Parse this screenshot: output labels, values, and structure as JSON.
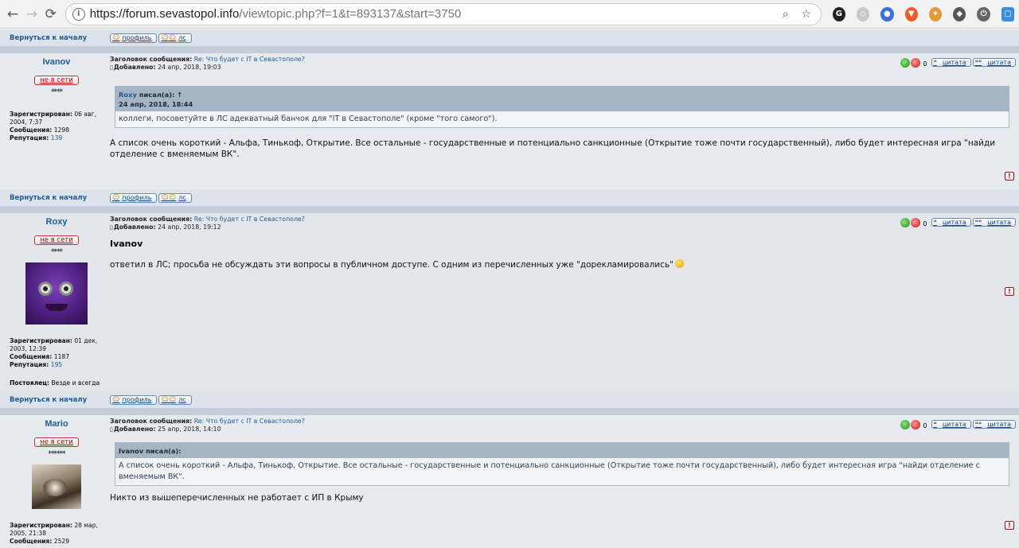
{
  "browser": {
    "url_host": "https://forum.sevastopol.info",
    "url_path": "/viewtopic.php?f=1&t=893137&start=3750",
    "back_icon": "arrow-left",
    "forward_icon": "arrow-right",
    "reload_icon": "reload",
    "info_icon": "info-circle",
    "zoom_icon": "magnifier",
    "bookmark_icon": "star"
  },
  "labels": {
    "back_to_top": "Вернуться к началу",
    "profile": "профиль",
    "pm": "лс",
    "offline": "не в сети",
    "quote": "цитата",
    "subject_label": "Заголовок сообщения:",
    "added_label": "Добавлено:",
    "registered_label": "Зарегистрирован:",
    "messages_label": "Сообщения:",
    "reputation_label": "Репутация:",
    "wrote": "писал(а):",
    "report": "!"
  },
  "posts": [
    {
      "author": "Ivanov",
      "stars": "****",
      "registered": "06 авг, 2004, 7:37",
      "messages": "1298",
      "reputation": "139",
      "subject": "Re: Что будет с IT в Севастополе?",
      "added": "24 апр, 2018, 19:03",
      "votes": "0",
      "quote": {
        "author": "Roxy",
        "arrow": "↑",
        "date": "24 апр, 2018, 18:44",
        "text": "коллеги, посоветуйте в ЛС адекватный банчок для \"IT в Севастополе\" (кроме \"того самого\")."
      },
      "text": "А список очень короткий - Альфа, Тинькоф, Открытие. Все остальные - государственные и потенциально санкционные (Открытие тоже почти государственный), либо будет интересная игра \"найди отделение с вменяемым ВК\"."
    },
    {
      "author": "Roxy",
      "stars": "****",
      "registered": "01 дек, 2003, 12:39",
      "messages": "1187",
      "reputation": "195",
      "lodger_label": "Постоялец:",
      "lodger_value": "Везде и всегда",
      "subject": "Re: Что будет с IT в Севастополе?",
      "added": "24 апр, 2018, 19:12",
      "votes": "0",
      "title": "Ivanov",
      "text": "ответил в ЛС; просьба не обсуждать эти вопросы в публичном доступе. С одним из перечисленных уже \"дорекламировались\""
    },
    {
      "author": "Mario",
      "stars": "******",
      "registered": "28 мар, 2005, 21:38",
      "messages": "2529",
      "subject": "Re: Что будет с IT в Севастополе?",
      "added": "25 апр, 2018, 14:10",
      "votes": "0",
      "quote": {
        "author": "Ivanov",
        "text": "А список очень короткий - Альфа, Тинькоф, Открытие. Все остальные - государственные и потенциально санкционные (Открытие тоже почти государственный), либо будет интересная игра \"найди отделение с вменяемым ВК\"."
      },
      "text": "Никто из вышеперечисленных не работает с ИП в Крыму"
    }
  ]
}
